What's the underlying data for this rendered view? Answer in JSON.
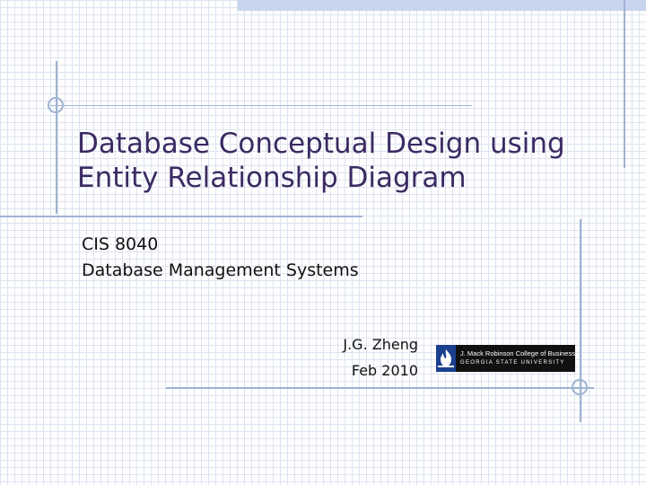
{
  "slide": {
    "title_line1": "Database Conceptual Design using",
    "title_line2": "Entity Relationship Diagram",
    "subtitle_line1": "CIS 8040",
    "subtitle_line2": "Database Management Systems",
    "author": "J.G. Zheng",
    "date": "Feb 2010"
  },
  "logo": {
    "line1": "J. Mack Robinson College of Business",
    "line2": "GEORGIA STATE UNIVERSITY",
    "icon": "flame-icon"
  },
  "colors": {
    "title": "#3b2a63",
    "text": "#111111",
    "accent_lines": "#9fb2d4",
    "top_bar": "#c7d5ef",
    "grid": "#dde3ee",
    "logo_blue": "#1a3f8f"
  }
}
